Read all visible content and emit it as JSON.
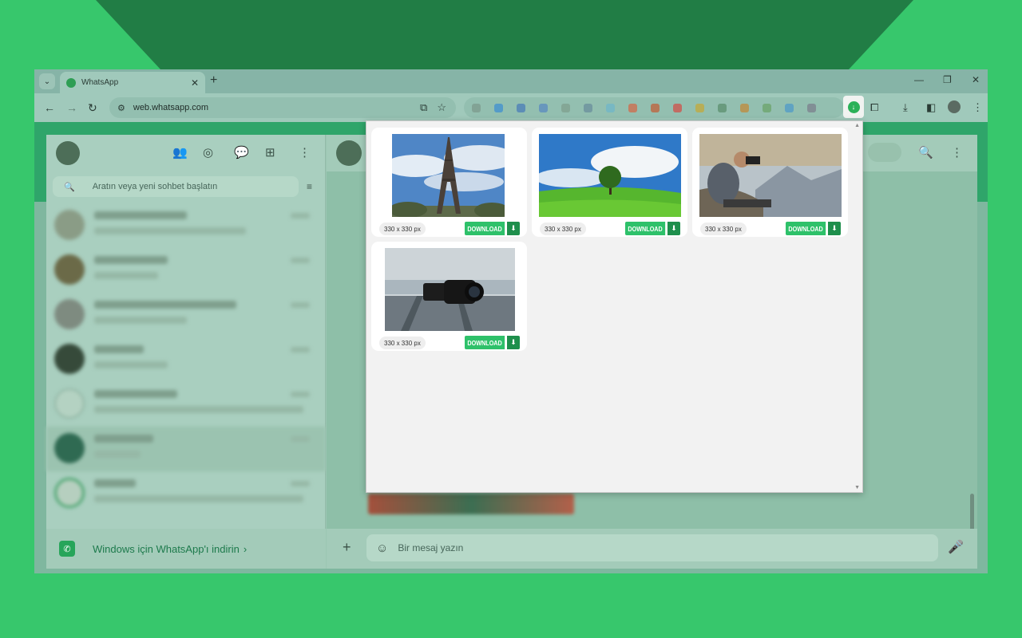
{
  "tab": {
    "title": "WhatsApp",
    "close": "✕",
    "new": "+"
  },
  "window_controls": [
    "—",
    "❐",
    "✕"
  ],
  "toolbar": {
    "url": "web.whatsapp.com"
  },
  "sidebar": {
    "search_placeholder": "Aratın veya yeni sohbet başlatın",
    "footer_text": "Windows için WhatsApp'ı indirin",
    "footer_chevron": "›"
  },
  "composer": {
    "placeholder": "Bir mesaj yazın"
  },
  "popup": {
    "cards": [
      {
        "size": "330 x 330 px",
        "button": "DOWNLOAD",
        "image": "eiffel-tower"
      },
      {
        "size": "330 x 330 px",
        "button": "DOWNLOAD",
        "image": "tree-on-green-hill"
      },
      {
        "size": "330 x 330 px",
        "button": "DOWNLOAD",
        "image": "photographer-on-rock"
      },
      {
        "size": "330 x 330 px",
        "button": "DOWNLOAD",
        "image": "camera-on-wooden-deck"
      }
    ]
  },
  "colors": {
    "accent": "#2ec16a",
    "accent_dark": "#1e8f4c",
    "background": "#37c76c"
  }
}
